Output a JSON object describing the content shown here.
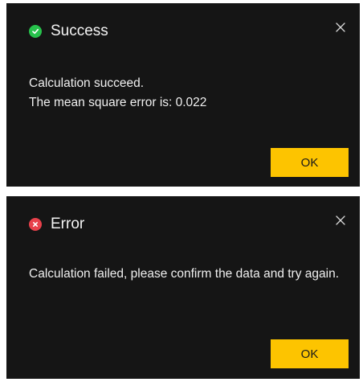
{
  "dialogs": {
    "success": {
      "title": "Success",
      "icon": "check-circle-icon",
      "icon_color": "#27c24c",
      "line1": "Calculation succeed.",
      "line2": "The mean square error is: 0.022",
      "ok_label": "OK",
      "close_icon": "close-icon"
    },
    "error": {
      "title": "Error",
      "icon": "error-circle-icon",
      "icon_color": "#e8414b",
      "message": "Calculation failed, please confirm the data and try again.",
      "ok_label": "OK",
      "close_icon": "close-icon"
    }
  },
  "colors": {
    "dialog_background": "#151515",
    "button_accent": "#fdc400",
    "text": "#f2f2f2"
  }
}
